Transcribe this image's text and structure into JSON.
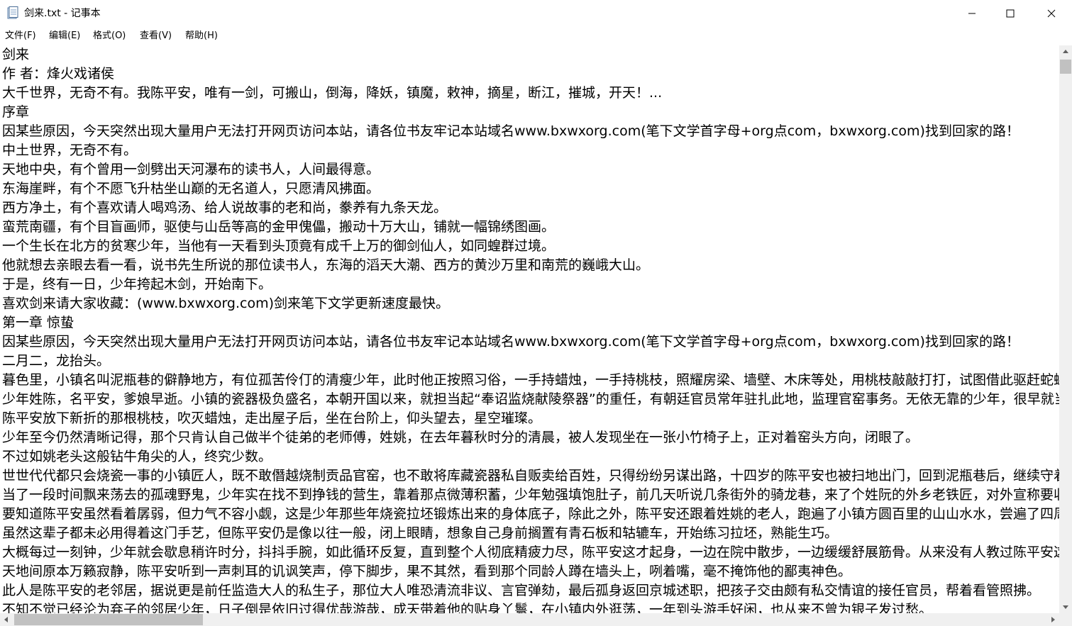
{
  "window": {
    "title": "剑来.txt - 记事本",
    "minimize_glyph": "—",
    "maximize_glyph": "☐",
    "close_glyph": "✕"
  },
  "menu": [
    {
      "label": "文件(F)"
    },
    {
      "label": "编辑(E)"
    },
    {
      "label": "格式(O)"
    },
    {
      "label": "查看(V)"
    },
    {
      "label": "帮助(H)"
    }
  ],
  "document": {
    "lines": [
      "剑来",
      "作  者：烽火戏诸侯",
      "大千世界，无奇不有。我陈平安，唯有一剑，可搬山，倒海，降妖，镇魔，敕神，摘星，断江，摧城，开天！...",
      "序章",
      "因某些原因，今天突然出现大量用户无法打开网页访问本站，请各位书友牢记本站域名www.bxwxorg.com(笔下文学首字母+org点com，bxwxorg.com)找到回家的路！",
      "中土世界，无奇不有。",
      "天地中央，有个曾用一剑劈出天河瀑布的读书人，人间最得意。",
      "东海崖畔，有个不愿飞升枯坐山巅的无名道人，只愿清风拂面。",
      "西方净土，有个喜欢请人喝鸡汤、给人说故事的老和尚，豢养有九条天龙。",
      "蛮荒南疆，有个目盲画师，驱使与山岳等高的金甲傀儡，搬动十万大山，铺就一幅锦绣图画。",
      "一个生长在北方的贫寒少年，当他有一天看到头顶竟有成千上万的御剑仙人，如同蝗群过境。",
      "他就想去亲眼去看一看，说书先生所说的那位读书人，东海的滔天大潮、西方的黄沙万里和南荒的巍峨大山。",
      "于是，终有一日，少年挎起木剑，开始南下。",
      "喜欢剑来请大家收藏：(www.bxwxorg.com)剑来笔下文学更新速度最快。",
      "第一章 惊蛰",
      "因某些原因，今天突然出现大量用户无法打开网页访问本站，请各位书友牢记本站域名www.bxwxorg.com(笔下文学首字母+org点com，bxwxorg.com)找到回家的路！",
      "二月二，龙抬头。",
      "暮色里，小镇名叫泥瓶巷的僻静地方，有位孤苦伶仃的清瘦少年，此时他正按照习俗，一手持蜡烛，一手持桃枝，照耀房梁、墙壁、木床等处，用桃枝敲敲打打，试图借此驱赶蛇蝎、蜈蚣等，嘴里念念有词",
      "少年姓陈，名平安，爹娘早逝。小镇的瓷器极负盛名，本朝开国以来，就担当起“奉诏监烧献陵祭器”的重任，有朝廷官员常年驻扎此地，监理官窑事务。无依无靠的少年，很早就当起了烧瓷的窑匠",
      "陈平安放下新折的那根桃枝，吹灭蜡烛，走出屋子后，坐在台阶上，仰头望去，星空璀璨。",
      "少年至今仍然清晰记得，那个只肯认自己做半个徒弟的老师傅，姓姚，在去年暮秋时分的清晨，被人发现坐在一张小竹椅子上，正对着窑头方向，闭眼了。",
      "不过如姚老头这般钻牛角尖的人，终究少数。",
      "世世代代都只会烧瓷一事的小镇匠人，既不敢僭越烧制贡品官窑，也不敢将库藏瓷器私自贩卖给百姓，只得纷纷另谋出路，十四岁的陈平安也被扫地出门，回到泥瓶巷后，继续守着这栋早已破败不堪的老宅",
      "当了一段时间飘来荡去的孤魂野鬼，少年实在找不到挣钱的营生，靠着那点微薄积蓄，少年勉强填饱肚子，前几天听说几条街外的骑龙巷，来了个姓阮的外乡老铁匠，对外宣称要收七八个打铁的学徒",
      "要知道陈平安虽然看着孱弱，但力气不容小觑，这是少年那些年烧瓷拉坯锻炼出来的身体底子，除此之外，陈平安还跟着姓姚的老人，跑遍了小镇方圆百里的山山水水，尝遍了四周各种土壤的滋味",
      "虽然这辈子都未必用得着这门手艺，但陈平安仍是像以往一般，闭上眼睛，想象自己身前搁置有青石板和轱辘车，开始练习拉坯，熟能生巧。",
      "大概每过一刻钟，少年就会歇息稍许时分，抖抖手腕，如此循环反复，直到整个人彻底精疲力尽，陈平安这才起身，一边在院中散步，一边缓缓舒展筋骨。从来没有人教过陈平安这些，是他自己瞎琢磨出来的",
      "天地间原本万籁寂静，陈平安听到一声刺耳的讥讽笑声，停下脚步，果不其然，看到那个同龄人蹲在墙头上，咧着嘴，毫不掩饰他的鄙夷神色。",
      "此人是陈平安的老邻居，据说更是前任监造大人的私生子，那位大人唯恐清流非议、言官弹劾，最后孤身返回京城述职，把孩子交由颇有私交情谊的接任官员，帮着看管照拂。",
      "不知不觉已经沦为弃子的邻居少年，日子倒是依旧过得优哉游哉，成天带着他的贴身丫鬟，在小镇内外逛荡，一年到头游手好闲，也从来不曾为银子发过愁。"
    ]
  }
}
